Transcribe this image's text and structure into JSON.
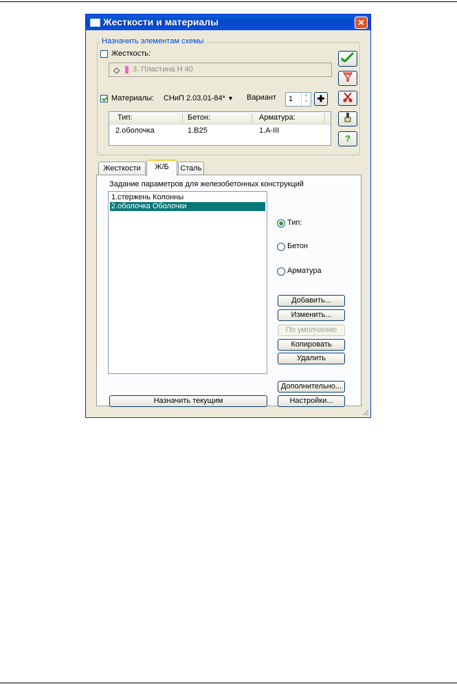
{
  "window": {
    "title": "Жесткости и материалы",
    "close_glyph": "✕"
  },
  "assign_group": {
    "legend": "Назначить элементам схемы",
    "stiffness_label": "Жесткость:",
    "stiffness_checked": false,
    "stiffness_value": "3. Пластина  H 40",
    "materials_label": "Материалы:",
    "materials_checked": true,
    "norm": "СНиП 2.03.01-84*",
    "variant_label": "Вариант",
    "variant_value": "1",
    "table": {
      "headers": [
        "Тип:",
        "Бетон:",
        "Арматура:"
      ],
      "row": [
        "2.оболочка",
        "1.B25",
        "1.A-III"
      ]
    }
  },
  "side_buttons": [
    {
      "name": "apply-icon",
      "color": "#1a9a1a"
    },
    {
      "name": "filter-icon",
      "color": "#c01818"
    },
    {
      "name": "cut-icon",
      "color": "#c01818"
    },
    {
      "name": "brush-icon",
      "color": "#404040"
    },
    {
      "name": "help-icon",
      "glyph": "?",
      "color": "#1a9a1a"
    }
  ],
  "tabs": [
    {
      "label": "Жесткости",
      "active": false
    },
    {
      "label": "Ж/Б",
      "active": true
    },
    {
      "label": "Сталь",
      "active": false
    }
  ],
  "panel": {
    "heading": "Задание параметров для железобетонных конструкций",
    "list_items": [
      {
        "label": "1.стержень Колонны",
        "selected": false
      },
      {
        "label": "2.оболочка Оболочки",
        "selected": true
      }
    ],
    "radios": [
      {
        "label": "Тип:",
        "checked": true
      },
      {
        "label": "Бетон",
        "checked": false
      },
      {
        "label": "Арматура",
        "checked": false
      }
    ],
    "buttons": {
      "add": "Добавить...",
      "edit": "Изменить...",
      "default": "По умолчанию",
      "copy": "Копировать",
      "delete": "Удалить",
      "more": "Дополнительно...",
      "settings": "Настройки...",
      "assign_current": "Назначить текущим"
    }
  },
  "colors": {
    "dialog_bg": "#ece9d8",
    "titlebar": "#0347c9",
    "selection": "#0a7878",
    "group_legend": "#0046d5"
  }
}
